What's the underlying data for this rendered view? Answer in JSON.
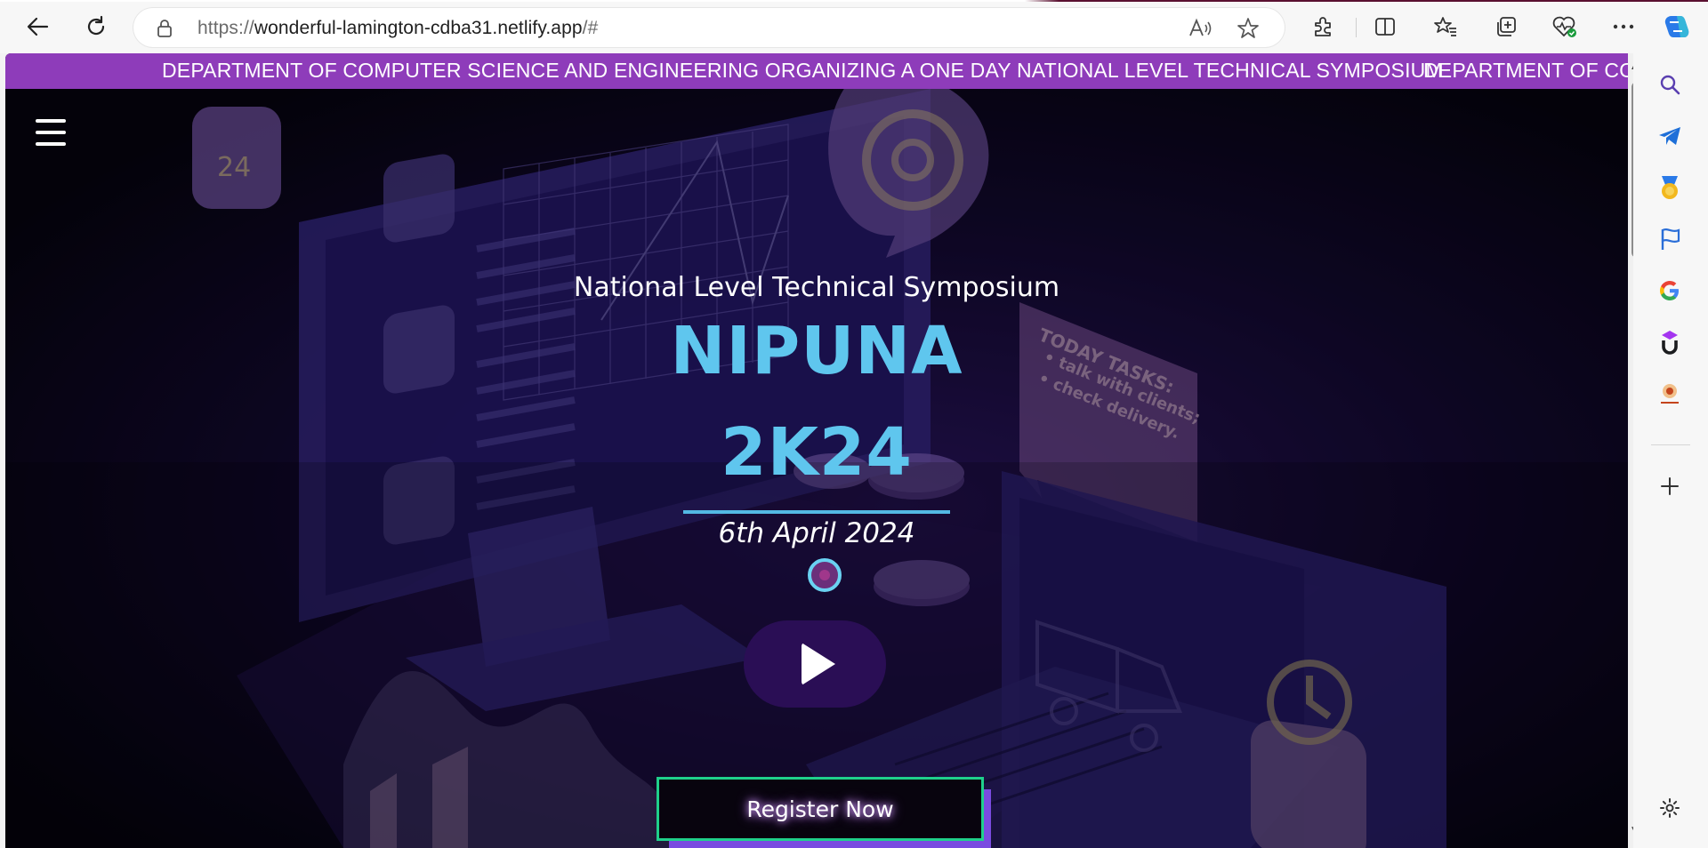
{
  "browser": {
    "url_prefix": "https://",
    "url_host": "wonderful-lamington-cdba31.netlify.app",
    "url_suffix": "/#"
  },
  "page": {
    "marquee_text": "DEPARTMENT OF COMPUTER SCIENCE AND ENGINEERING ORGANIZING A ONE DAY NATIONAL LEVEL TECHNICAL SYMPOSIUM",
    "marquee_repeat": "DEPARTMENT OF COM",
    "subtitle": "National Level Technical Symposium",
    "title_line1": "NIPUNA",
    "title_line2": "2K24",
    "date": "6th April 2024",
    "register_label": "Register Now"
  },
  "background": {
    "calendar_label": "24",
    "tasks_title": "TODAY TASKS:",
    "task_1": "• talk with clients;",
    "task_2": "• check delivery."
  },
  "colors": {
    "marquee_bg": "#8e3cba",
    "title": "#5fc6ee",
    "register_border": "#1fd08b",
    "register_shadow": "#7a4be0"
  }
}
